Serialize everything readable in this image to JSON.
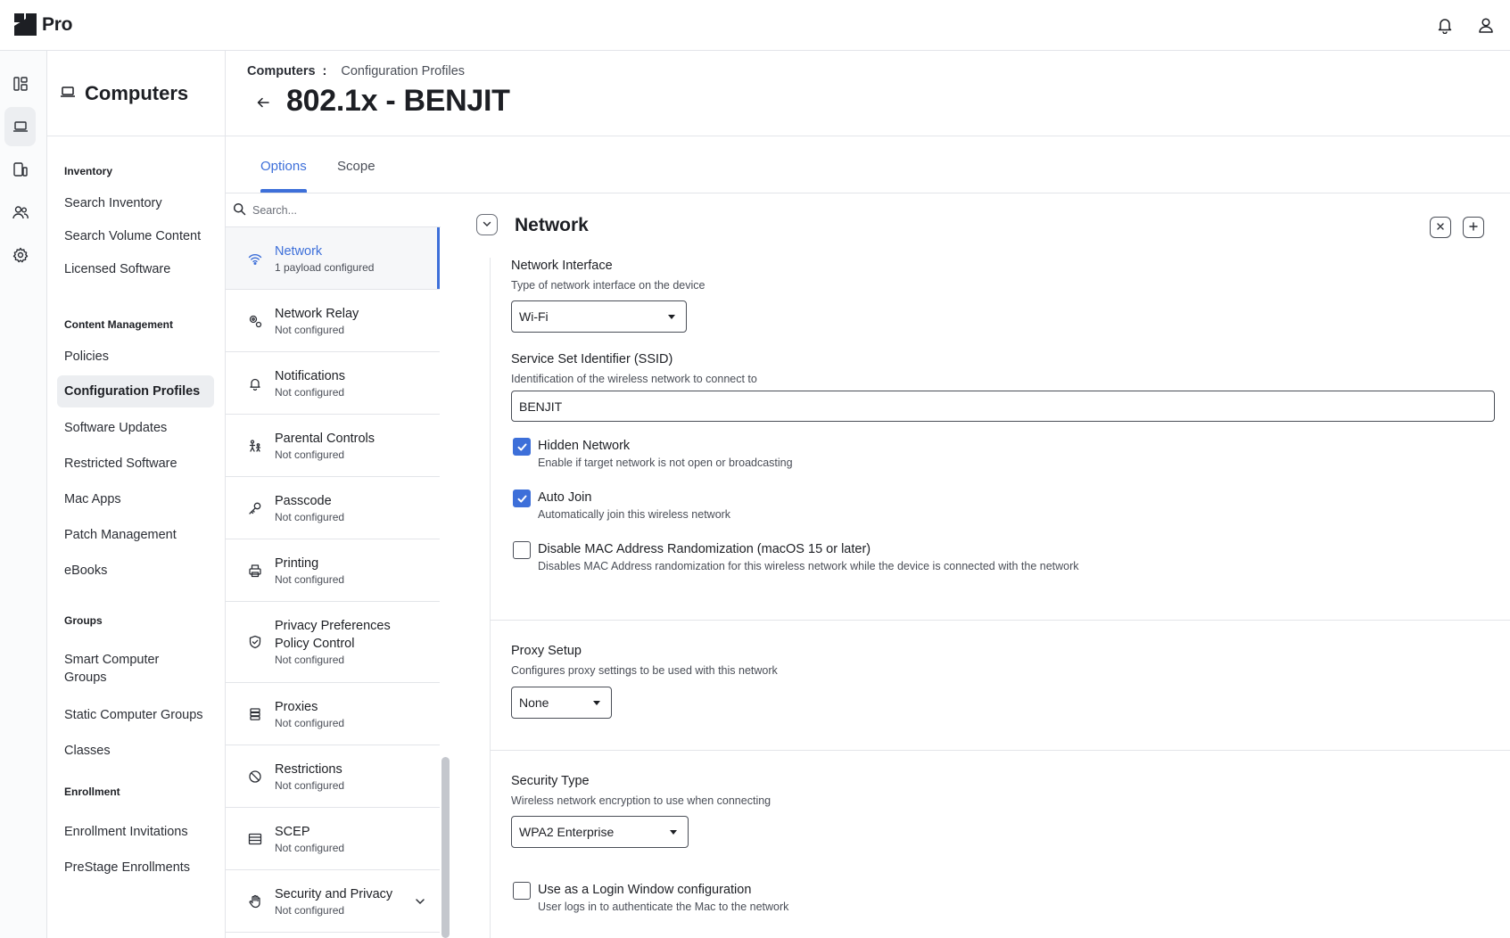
{
  "app": {
    "name": "Pro",
    "notification_icon": "bell-icon",
    "account_icon": "user-icon"
  },
  "rail": {
    "items": [
      {
        "icon": "dashboard-icon",
        "active": false
      },
      {
        "icon": "laptop-icon",
        "active": true
      },
      {
        "icon": "devices-icon",
        "active": false
      },
      {
        "icon": "users-icon",
        "active": false
      },
      {
        "icon": "gear-icon",
        "active": false
      }
    ]
  },
  "subnav": {
    "title": "Computers",
    "sections": [
      {
        "label": "Inventory",
        "items": [
          "Search Inventory",
          "Search Volume Content",
          "Licensed Software"
        ]
      },
      {
        "label": "Content Management",
        "items": [
          "Policies",
          "Configuration Profiles",
          "Software Updates",
          "Restricted Software",
          "Mac Apps",
          "Patch Management",
          "eBooks"
        ]
      },
      {
        "label": "Groups",
        "items": [
          "Smart Computer Groups",
          "Static Computer Groups",
          "Classes"
        ]
      },
      {
        "label": "Enrollment",
        "items": [
          "Enrollment Invitations",
          "PreStage Enrollments"
        ]
      }
    ],
    "active_item": "Configuration Profiles"
  },
  "breadcrumb": {
    "root": "Computers",
    "separator": ":",
    "current": "Configuration Profiles"
  },
  "page": {
    "title": "802.1x - BENJIT"
  },
  "tabs": [
    {
      "label": "Options",
      "active": true
    },
    {
      "label": "Scope",
      "active": false
    }
  ],
  "payloads": {
    "search_placeholder": "Search...",
    "items": [
      {
        "name": "Network",
        "status": "1 payload configured",
        "icon": "wifi-icon",
        "active": true
      },
      {
        "name": "Network Relay",
        "status": "Not configured",
        "icon": "relay-icon",
        "active": false
      },
      {
        "name": "Notifications",
        "status": "Not configured",
        "icon": "bell-icon",
        "active": false
      },
      {
        "name": "Parental Controls",
        "status": "Not configured",
        "icon": "family-icon",
        "active": false
      },
      {
        "name": "Passcode",
        "status": "Not configured",
        "icon": "key-icon",
        "active": false
      },
      {
        "name": "Printing",
        "status": "Not configured",
        "icon": "printer-icon",
        "active": false
      },
      {
        "name": "Privacy Preferences Policy Control",
        "status": "Not configured",
        "icon": "shield-icon",
        "active": false
      },
      {
        "name": "Proxies",
        "status": "Not configured",
        "icon": "server-icon",
        "active": false
      },
      {
        "name": "Restrictions",
        "status": "Not configured",
        "icon": "block-icon",
        "active": false
      },
      {
        "name": "SCEP",
        "status": "Not configured",
        "icon": "certificate-icon",
        "active": false
      },
      {
        "name": "Security and Privacy",
        "status": "Not configured",
        "icon": "hand-icon",
        "active": false,
        "expandable": true
      }
    ]
  },
  "network": {
    "section_title": "Network",
    "interface": {
      "label": "Network Interface",
      "description": "Type of network interface on the device",
      "value": "Wi-Fi"
    },
    "ssid": {
      "label": "Service Set Identifier (SSID)",
      "description": "Identification of the wireless network to connect to",
      "value": "BENJIT"
    },
    "hidden_network": {
      "label": "Hidden Network",
      "description": "Enable if target network is not open or broadcasting",
      "checked": true
    },
    "auto_join": {
      "label": "Auto Join",
      "description": "Automatically join this wireless network",
      "checked": true
    },
    "mac_randomization": {
      "label": "Disable MAC Address Randomization (macOS 15 or later)",
      "description": "Disables MAC Address randomization for this wireless network while the device is connected with the network",
      "checked": false
    },
    "proxy": {
      "label": "Proxy Setup",
      "description": "Configures proxy settings to be used with this network",
      "value": "None"
    },
    "security": {
      "label": "Security Type",
      "description": "Wireless network encryption to use when connecting",
      "value": "WPA2 Enterprise"
    },
    "login_window": {
      "label": "Use as a Login Window configuration",
      "description": "User logs in to authenticate the Mac to the network",
      "checked": false
    }
  },
  "colors": {
    "accent": "#3d6fd9",
    "border": "#e3e5e9",
    "text": "#1d1f24"
  }
}
